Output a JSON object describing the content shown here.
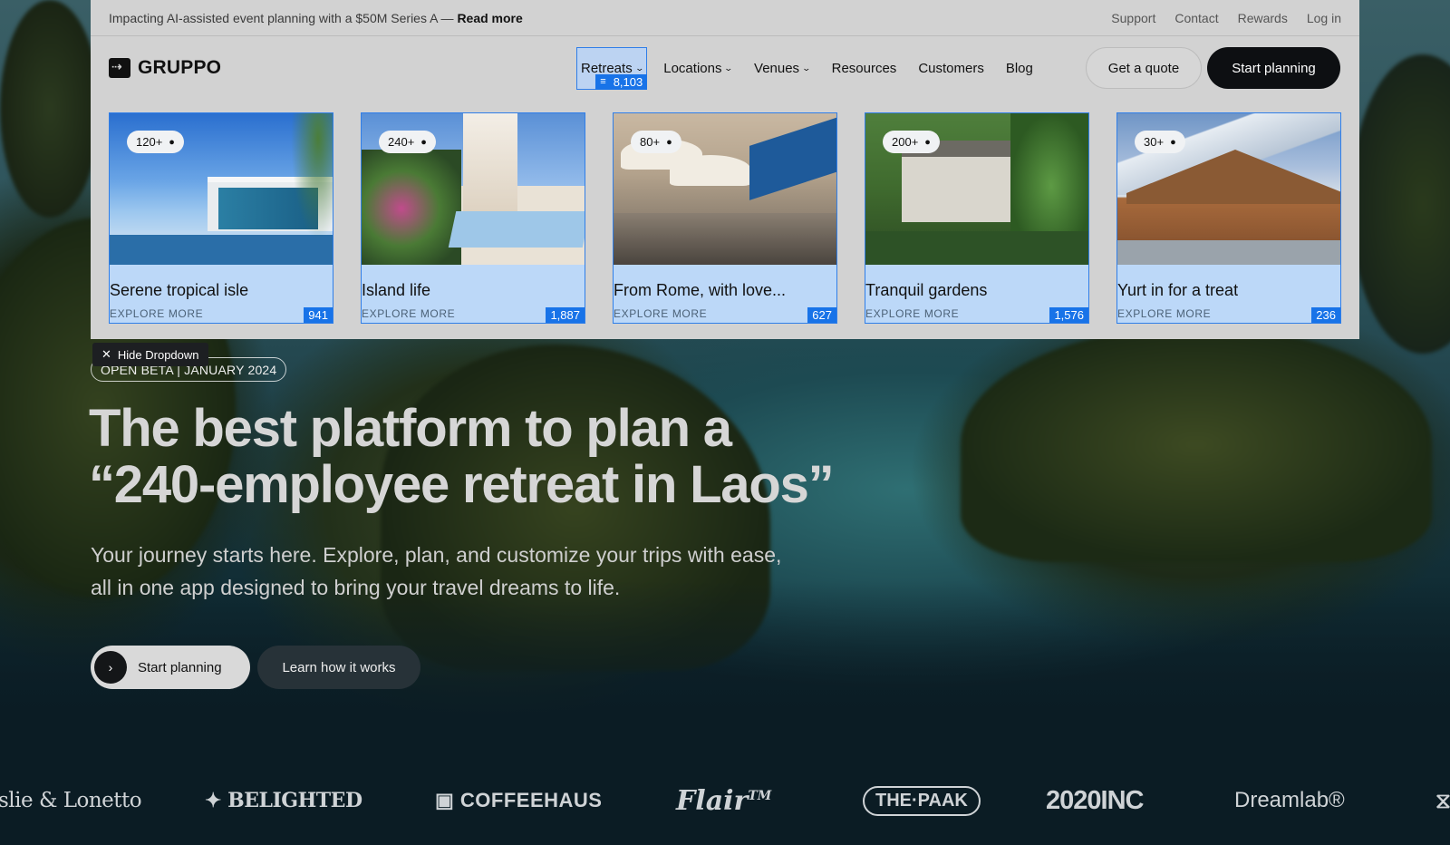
{
  "announcement": {
    "text": "Impacting AI-assisted event planning with a $50M Series A — ",
    "link": "Read more"
  },
  "utility_links": [
    "Support",
    "Contact",
    "Rewards",
    "Log in"
  ],
  "brand": {
    "name": "GRUPPO",
    "logo_icon": "gruppo-logo-icon"
  },
  "nav": {
    "items": [
      {
        "label": "Retreats",
        "dropdown": true
      },
      {
        "label": "Locations",
        "dropdown": true
      },
      {
        "label": "Venues",
        "dropdown": true
      },
      {
        "label": "Resources",
        "dropdown": false
      },
      {
        "label": "Customers",
        "dropdown": false
      },
      {
        "label": "Blog",
        "dropdown": false
      }
    ],
    "retreats_count": "8,103",
    "quote_button": "Get a quote",
    "plan_button": "Start planning"
  },
  "retreat_cards": [
    {
      "capacity": "120+",
      "title": "Serene tropical isle",
      "explore": "EXPLORE MORE",
      "count": "941"
    },
    {
      "capacity": "240+",
      "title": "Island life",
      "explore": "EXPLORE MORE",
      "count": "1,887"
    },
    {
      "capacity": "80+",
      "title": "From Rome, with love...",
      "explore": "EXPLORE MORE",
      "count": "627"
    },
    {
      "capacity": "200+",
      "title": "Tranquil gardens",
      "explore": "EXPLORE MORE",
      "count": "1,576"
    },
    {
      "capacity": "30+",
      "title": "Yurt in for a treat",
      "explore": "EXPLORE MORE",
      "count": "236"
    }
  ],
  "hide_dropdown": "Hide Dropdown",
  "hero": {
    "badge": "OPEN BETA | JANUARY 2024",
    "headline_line1": "The best platform to plan a",
    "headline_line2": "“240-employee retreat in Laos”",
    "subtext": "Your journey starts here. Explore, plan, and customize your trips with ease, all in one app designed to bring your travel dreams to life.",
    "primary_cta": "Start planning",
    "secondary_cta": "Learn how it works"
  },
  "client_logos": [
    "slie & Lonetto",
    "BELIGHTED",
    "COFFEEHAUS",
    "Flair",
    "THE·PAAK",
    "2020INC",
    "Dreamlab®",
    ""
  ],
  "colors": {
    "accent_blue": "#1873e8",
    "panel_bg": "#d2d2d2",
    "dark_button": "#0d0f12"
  }
}
